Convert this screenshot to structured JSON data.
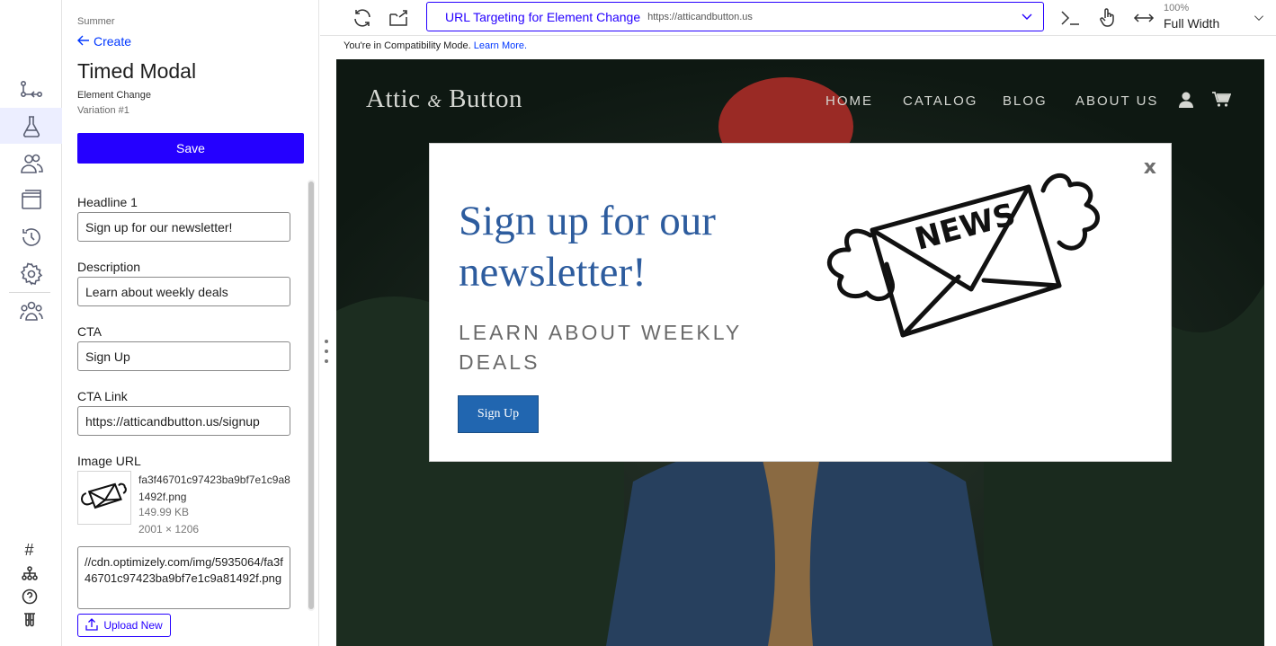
{
  "panel": {
    "breadcrumb": "Summer",
    "back_label": "Create",
    "title": "Timed Modal",
    "type": "Element Change",
    "variation": "Variation #1",
    "save_label": "Save",
    "fields": {
      "headline_label": "Headline 1",
      "headline_value": "Sign up for our newsletter!",
      "description_label": "Description",
      "description_value": "Learn about weekly deals",
      "cta_label": "CTA",
      "cta_value": "Sign Up",
      "cta_link_label": "CTA Link",
      "cta_link_value": "https://atticandbutton.us/signup",
      "image_label": "Image URL"
    },
    "image": {
      "file_name": "fa3f46701c97423ba9bf7e1c9a81492f.png",
      "file_size": "149.99 KB",
      "dimensions": "2001 × 1206",
      "url": "//cdn.optimizely.com/img/5935064/fa3f46701c97423ba9bf7e1c9a81492f.png",
      "upload_label": "Upload New"
    }
  },
  "toolbar": {
    "url_title": "URL Targeting for Element Change",
    "url": "https://atticandbutton.us",
    "zoom_pct": "100%",
    "zoom_label": "Full Width"
  },
  "compat": {
    "text": "You're in Compatibility Mode.",
    "link": "Learn More."
  },
  "site": {
    "logo_main": "Attic",
    "logo_amp": "&",
    "logo_tail": "Button",
    "nav": [
      "HOME",
      "CATALOG",
      "BLOG",
      "ABOUT US"
    ]
  },
  "modal": {
    "close": "x",
    "headline": "Sign up for our newsletter!",
    "description": "Learn about weekly deals",
    "cta": "Sign Up",
    "image_text": "NEWS"
  },
  "colors": {
    "accent": "#2500ff",
    "link": "#0037ff",
    "modal_headline": "#2d5c9e",
    "modal_button": "#2166b0"
  }
}
